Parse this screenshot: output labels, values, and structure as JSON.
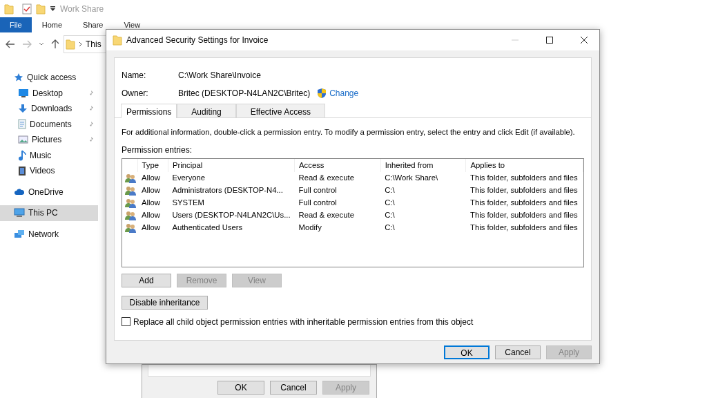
{
  "explorer": {
    "title": "Work Share",
    "ribbon_tabs": [
      {
        "label": "File",
        "selected": true
      },
      {
        "label": "Home",
        "selected": false
      },
      {
        "label": "Share",
        "selected": false
      },
      {
        "label": "View",
        "selected": false
      }
    ],
    "address": {
      "crumb": "This"
    },
    "sidebar": {
      "items": [
        {
          "label": "Quick access",
          "selected": false,
          "children": [
            {
              "label": "Desktop",
              "pinned": true,
              "selected": false
            },
            {
              "label": "Downloads",
              "pinned": true,
              "selected": false
            },
            {
              "label": "Documents",
              "pinned": true,
              "selected": false
            },
            {
              "label": "Pictures",
              "pinned": true,
              "selected": false
            },
            {
              "label": "Music",
              "pinned": false,
              "selected": false
            },
            {
              "label": "Videos",
              "pinned": false,
              "selected": false
            }
          ]
        },
        {
          "label": "OneDrive",
          "selected": false
        },
        {
          "label": "This PC",
          "selected": true
        },
        {
          "label": "Network",
          "selected": false
        }
      ]
    }
  },
  "back_dialog": {
    "buttons": [
      {
        "label": "OK",
        "disabled": false
      },
      {
        "label": "Cancel",
        "disabled": false
      },
      {
        "label": "Apply",
        "disabled": true
      }
    ]
  },
  "dialog": {
    "title": "Advanced Security Settings for Invoice",
    "name_label": "Name:",
    "name_value": "C:\\Work Share\\Invoice",
    "owner_label": "Owner:",
    "owner_value": "Britec (DESKTOP-N4LAN2C\\Britec)",
    "change_link": "Change",
    "tabs": [
      {
        "label": "Permissions",
        "selected": true
      },
      {
        "label": "Auditing",
        "selected": false
      },
      {
        "label": "Effective Access",
        "selected": false
      }
    ],
    "info": "For additional information, double-click a permission entry. To modify a permission entry, select the entry and click Edit (if available).",
    "entries_label": "Permission entries:",
    "table": {
      "columns": [
        "Type",
        "Principal",
        "Access",
        "Inherited from",
        "Applies to"
      ],
      "rows": [
        [
          "Allow",
          "Everyone",
          "Read & execute",
          "C:\\Work Share\\",
          "This folder, subfolders and files"
        ],
        [
          "Allow",
          "Administrators (DESKTOP-N4...",
          "Full control",
          "C:\\",
          "This folder, subfolders and files"
        ],
        [
          "Allow",
          "SYSTEM",
          "Full control",
          "C:\\",
          "This folder, subfolders and files"
        ],
        [
          "Allow",
          "Users (DESKTOP-N4LAN2C\\Us...",
          "Read & execute",
          "C:\\",
          "This folder, subfolders and files"
        ],
        [
          "Allow",
          "Authenticated Users",
          "Modify",
          "C:\\",
          "This folder, subfolders and files"
        ]
      ]
    },
    "entry_buttons": [
      {
        "label": "Add",
        "disabled": false
      },
      {
        "label": "Remove",
        "disabled": true
      },
      {
        "label": "View",
        "disabled": true
      }
    ],
    "inheritance_button": {
      "label": "Disable inheritance",
      "disabled": false
    },
    "replace_checkbox": {
      "label": "Replace all child object permission entries with inheritable permission entries from this object",
      "checked": false
    },
    "buttons": [
      {
        "label": "OK",
        "disabled": false,
        "default": true
      },
      {
        "label": "Cancel",
        "disabled": false,
        "default": false
      },
      {
        "label": "Apply",
        "disabled": true,
        "default": false
      }
    ]
  }
}
